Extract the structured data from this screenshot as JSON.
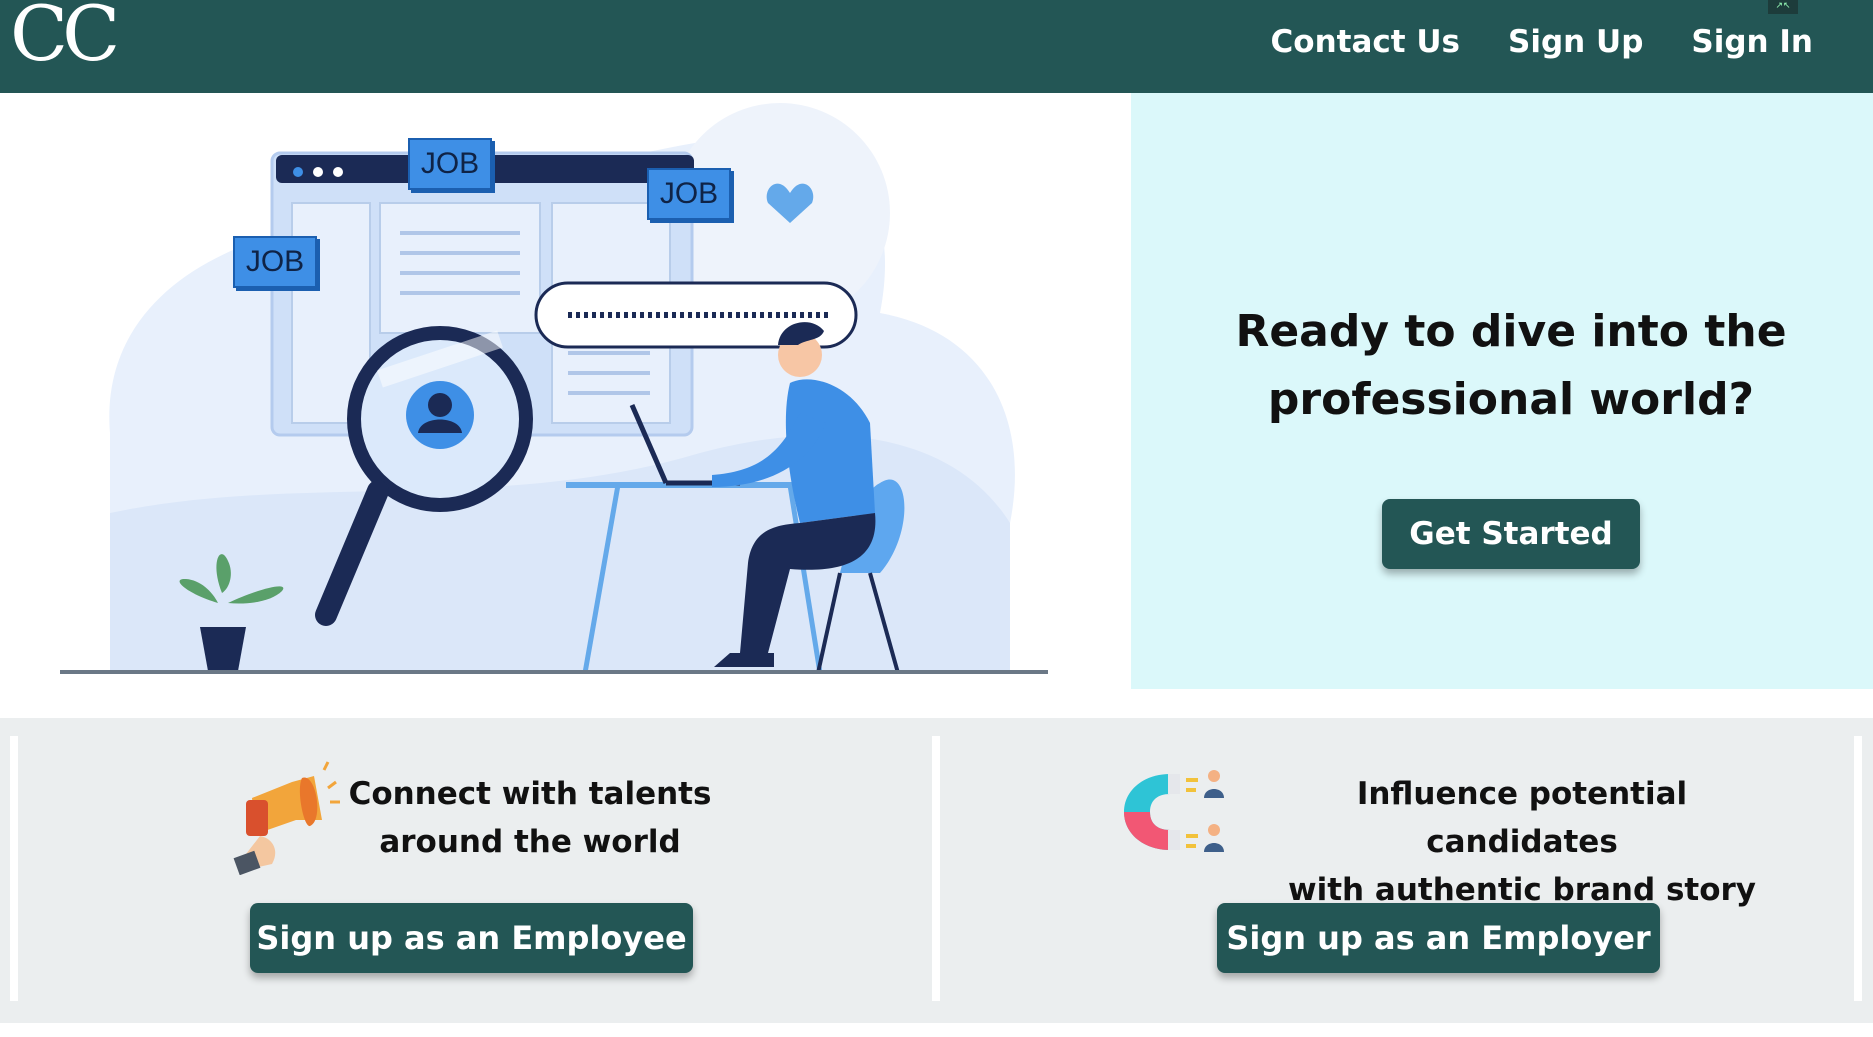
{
  "header": {
    "logo": "CC",
    "nav": [
      {
        "label": "Contact Us"
      },
      {
        "label": "Sign Up"
      },
      {
        "label": "Sign In"
      }
    ]
  },
  "hero": {
    "illustration_tags": [
      "JOB",
      "JOB",
      "JOB"
    ],
    "title": "Ready to dive into the professional world?",
    "cta_label": "Get Started"
  },
  "features": [
    {
      "title_line1": "Connect with talents",
      "title_line2": "around the world",
      "button_label": "Sign up as an Employee",
      "icon": "megaphone-icon"
    },
    {
      "title_line1": "Influence potential candidates",
      "title_line2": "with authentic brand story",
      "button_label": "Sign up as an Employer",
      "icon": "magnet-icon"
    }
  ],
  "colors": {
    "primary": "#235655",
    "hero_panel": "#dbf8fa",
    "section_bg": "#ebeeef",
    "illustration_blue": "#3e8fe6",
    "illustration_navy": "#1b2a55"
  }
}
